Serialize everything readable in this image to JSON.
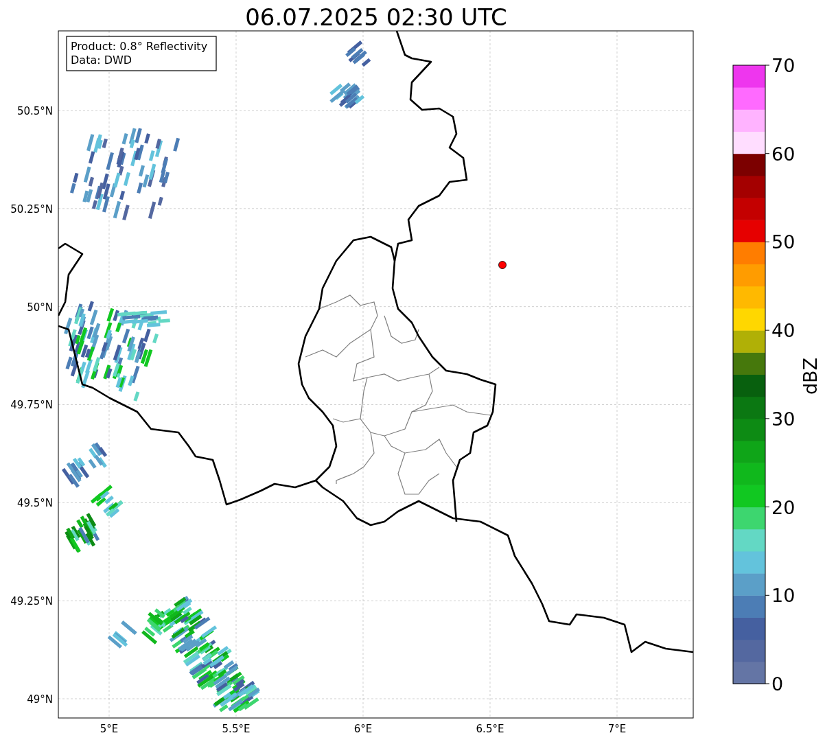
{
  "title": "06.07.2025 02:30 UTC",
  "info_box": [
    "Product: 0.8° Reflectivity",
    "Data: DWD"
  ],
  "lat_labels": [
    "50.5°N",
    "50.25°N",
    "50°N",
    "49.75°N",
    "49.5°N",
    "49.25°N",
    "49°N"
  ],
  "lon_labels": [
    "5°E",
    "5.5°E",
    "6°E",
    "6.5°E",
    "7°E"
  ],
  "colorbar": {
    "label": "dBZ",
    "ticks": [
      "70",
      "60",
      "50",
      "40",
      "30",
      "20",
      "10",
      "0"
    ]
  }
}
